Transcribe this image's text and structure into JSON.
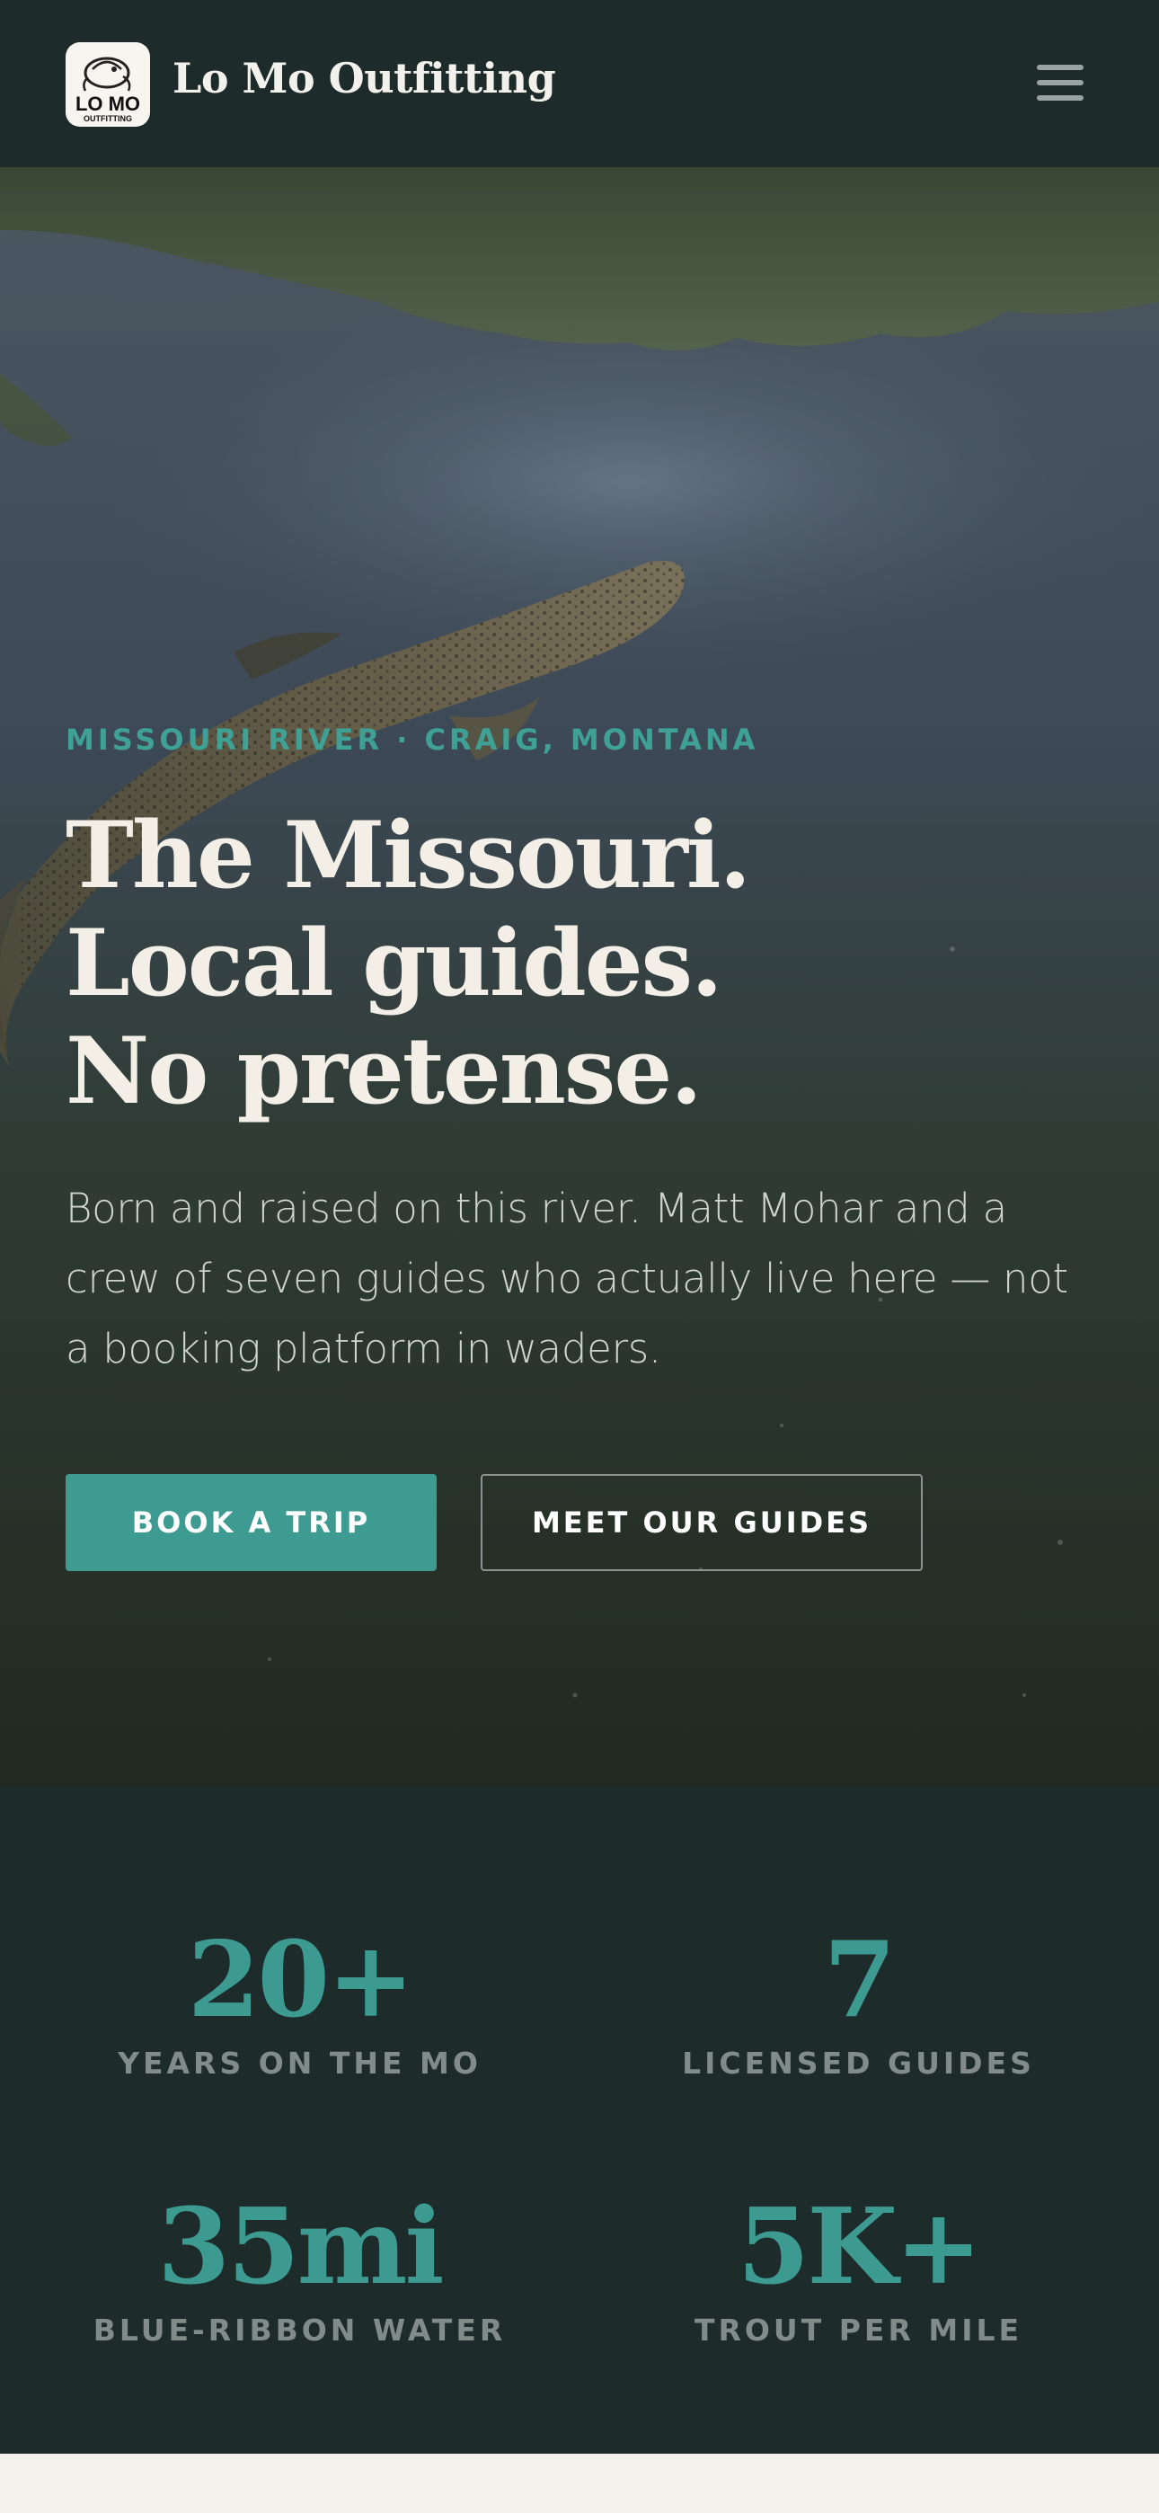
{
  "header": {
    "brand": "Lo Mo Outfitting",
    "logo_text_main": "LO MO",
    "logo_text_sub": "OUTFITTING",
    "menu_icon": "hamburger-menu-icon"
  },
  "hero": {
    "eyebrow": "MISSOURI RIVER · CRAIG, MONTANA",
    "headline_lines": [
      "The Missouri.",
      "Local guides.",
      "No pretense."
    ],
    "lede": "Born and raised on this river. Matt Mohar and a crew of seven guides who actually live here — not a booking platform in waders.",
    "primary_cta": "BOOK A TRIP",
    "secondary_cta": "MEET OUR GUIDES"
  },
  "stats": [
    {
      "value": "20+",
      "label": "YEARS ON THE MO"
    },
    {
      "value": "7",
      "label": "LICENSED GUIDES"
    },
    {
      "value": "35mi",
      "label": "BLUE-RIBBON WATER"
    },
    {
      "value": "5K+",
      "label": "TROUT PER MILE"
    }
  ],
  "colors": {
    "dark_bg": "#1e2b2b",
    "accent_teal": "#3d9b91",
    "cream": "#f3f1ec"
  }
}
